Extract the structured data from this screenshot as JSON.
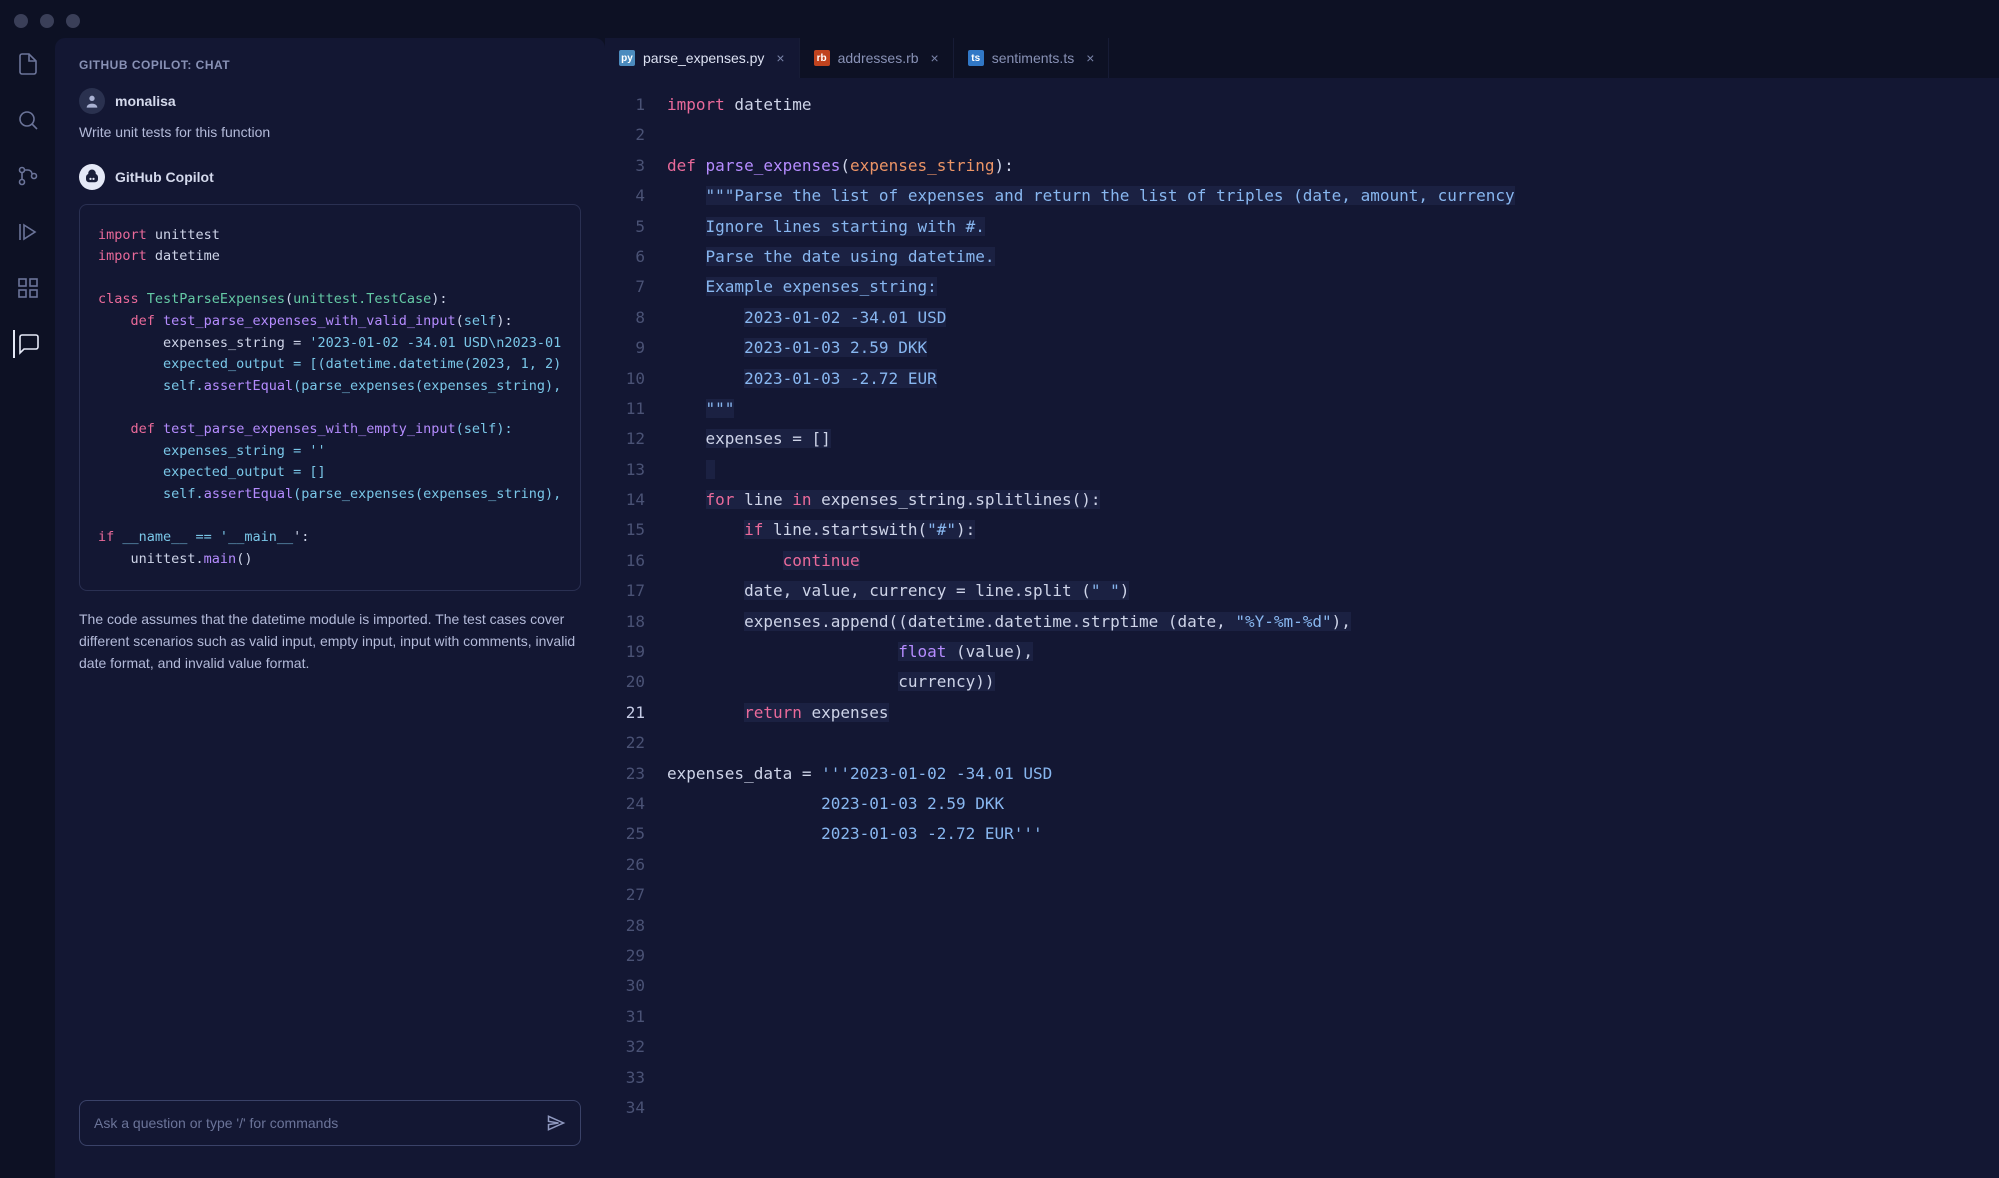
{
  "chat": {
    "title": "GITHUB COPILOT: CHAT",
    "user_name": "monalisa",
    "user_message": "Write unit tests for this function",
    "assistant_name": "GitHub Copilot",
    "assistant_code": "import unittest\nimport datetime\n\nclass TestParseExpenses(unittest.TestCase):\n    def test_parse_expenses_with_valid_input(self):\n        expenses_string = '2023-01-02 -34.01 USD\\n2023-01\n        expected_output = [(datetime.datetime(2023, 1, 2)\n        self.assertEqual(parse_expenses(expenses_string),\n\n    def test_parse_expenses_with_empty_input(self):\n        expenses_string = ''\n        expected_output = []\n        self.assertEqual(parse_expenses(expenses_string),\n\nif __name__ == '__main__':\n    unittest.main()",
    "assistant_explain": "The code assumes that the datetime module is imported. The test cases cover different scenarios such as valid input, empty input, input with comments, invalid date format, and invalid value format.",
    "input_placeholder": "Ask a question or type '/' for commands"
  },
  "tabs": [
    {
      "label": "parse_expenses.py",
      "icon": "py",
      "active": true
    },
    {
      "label": "addresses.rb",
      "icon": "rb",
      "active": false
    },
    {
      "label": "sentiments.ts",
      "icon": "ts",
      "active": false
    }
  ],
  "editor": {
    "current_line": 21,
    "total_lines": 34,
    "lines": [
      {
        "n": 1,
        "html": "<span class='kw'>import</span> datetime"
      },
      {
        "n": 2,
        "html": ""
      },
      {
        "n": 3,
        "html": "<span class='kw'>def</span> <span class='fn'>parse_expenses</span>(<span class='param'>expenses_string</span>):"
      },
      {
        "n": 4,
        "html": "    <span class='str str-bg'>\"\"\"Parse the list of expenses and return the list of triples (date, amount, currency</span>"
      },
      {
        "n": 5,
        "html": "    <span class='str str-bg'>Ignore lines starting with #.</span>"
      },
      {
        "n": 6,
        "html": "    <span class='str str-bg'>Parse the date using datetime.</span>"
      },
      {
        "n": 7,
        "html": "    <span class='str str-bg'>Example expenses_string:</span>"
      },
      {
        "n": 8,
        "html": "        <span class='str str-bg'>2023-01-02 -34.01 USD</span>"
      },
      {
        "n": 9,
        "html": "        <span class='str str-bg'>2023-01-03 2.59 DKK</span>"
      },
      {
        "n": 10,
        "html": "        <span class='str str-bg'>2023-01-03 -2.72 EUR</span>"
      },
      {
        "n": 11,
        "html": "    <span class='str str-bg'>\"\"\"</span>"
      },
      {
        "n": 12,
        "html": "    <span class='hl'>expenses = []</span>"
      },
      {
        "n": 13,
        "html": "    <span class='hl'> </span>"
      },
      {
        "n": 14,
        "html": "    <span class='hl'><span class='kw'>for</span> line <span class='kw'>in</span> expenses_string.splitlines():</span>"
      },
      {
        "n": 15,
        "html": "        <span class='hl'><span class='kw'>if</span> line.startswith(<span class='str'>\"#\"</span>):</span>"
      },
      {
        "n": 16,
        "html": "            <span class='hl'><span class='kw'>continue</span></span>"
      },
      {
        "n": 17,
        "html": "        <span class='hl'>date, value, currency = line.split (<span class='str'>\" \"</span>)</span>"
      },
      {
        "n": 18,
        "html": "        <span class='hl'>expenses.append((datetime.datetime.strptime (date, </span><span class='str str-bg'>\"%Y-%m-%d\"</span><span class='hl'>),</span>"
      },
      {
        "n": 19,
        "html": "                        <span class='hl'><span class='fn'>float</span> (value),</span>"
      },
      {
        "n": 20,
        "html": "                        <span class='hl'>currency))</span>"
      },
      {
        "n": 21,
        "html": "        <span class='hl'><span class='kw'>return</span> expenses</span>"
      },
      {
        "n": 22,
        "html": ""
      },
      {
        "n": 23,
        "html": "expenses_data = <span class='str'>'''2023-01-02 -34.01 USD</span>"
      },
      {
        "n": 24,
        "html": "                <span class='str'>2023-01-03 2.59 DKK</span>"
      },
      {
        "n": 25,
        "html": "                <span class='str'>2023-01-03 -2.72 EUR'''</span>"
      },
      {
        "n": 26,
        "html": ""
      },
      {
        "n": 27,
        "html": ""
      },
      {
        "n": 28,
        "html": ""
      },
      {
        "n": 29,
        "html": ""
      },
      {
        "n": 30,
        "html": ""
      },
      {
        "n": 31,
        "html": ""
      },
      {
        "n": 32,
        "html": ""
      },
      {
        "n": 33,
        "html": ""
      },
      {
        "n": 34,
        "html": ""
      }
    ]
  }
}
